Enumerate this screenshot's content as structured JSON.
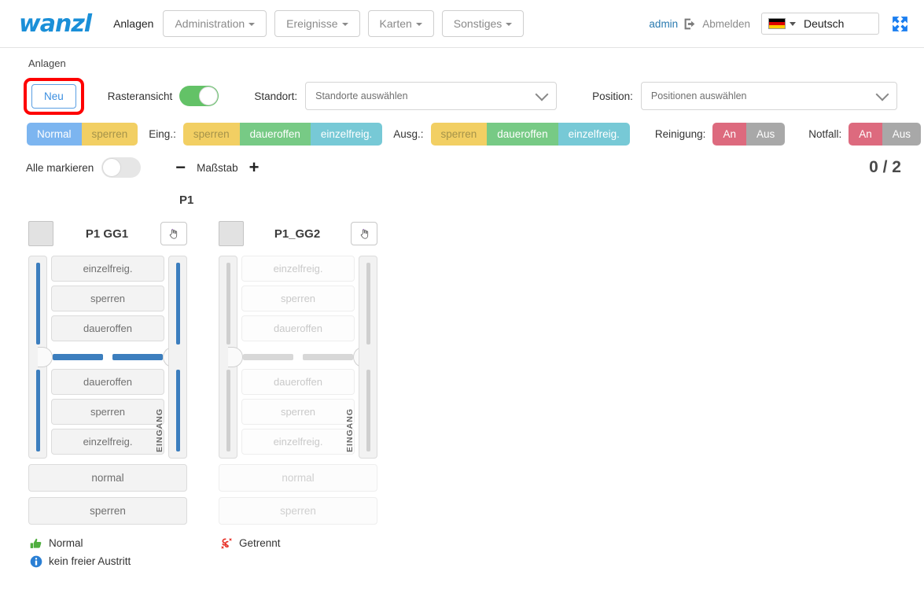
{
  "header": {
    "brand": "wanzl",
    "nav_plain": "Anlagen",
    "nav_buttons": [
      {
        "label": "Administration"
      },
      {
        "label": "Ereignisse"
      },
      {
        "label": "Karten"
      },
      {
        "label": "Sonstiges"
      }
    ],
    "user": "admin",
    "logout_label": "Abmelden",
    "language": "Deutsch",
    "language_flag": "de-flag-icon",
    "fullscreen_icon": "fullscreen-expand-icon"
  },
  "breadcrumb": "Anlagen",
  "toolbar": {
    "new_button": "Neu",
    "raster_label": "Rasteransicht",
    "raster_on": true,
    "standort_label": "Standort:",
    "standort_placeholder": "Standorte auswählen",
    "position_label": "Position:",
    "position_placeholder": "Positionen auswählen"
  },
  "modes": {
    "main": [
      {
        "label": "Normal",
        "style": "c-blue"
      },
      {
        "label": "sperren",
        "style": "c-yellow"
      }
    ],
    "eingang_label": "Eing.:",
    "eingang": [
      {
        "label": "sperren",
        "style": "c-yellow"
      },
      {
        "label": "daueroffen",
        "style": "c-green"
      },
      {
        "label": "einzelfreig.",
        "style": "c-teal"
      }
    ],
    "ausgang_label": "Ausg.:",
    "ausgang": [
      {
        "label": "sperren",
        "style": "c-yellow"
      },
      {
        "label": "daueroffen",
        "style": "c-green"
      },
      {
        "label": "einzelfreig.",
        "style": "c-teal"
      }
    ],
    "reinigung_label": "Reinigung:",
    "reinigung": [
      {
        "label": "An",
        "style": "c-red"
      },
      {
        "label": "Aus",
        "style": "c-gray"
      }
    ],
    "notfall_label": "Notfall:",
    "notfall": [
      {
        "label": "An",
        "style": "c-red"
      },
      {
        "label": "Aus",
        "style": "c-gray"
      }
    ]
  },
  "selection": {
    "select_all_label": "Alle markieren",
    "select_all_on": false,
    "minus": "−",
    "scale_label": "Maßstab",
    "plus": "+",
    "counter": "0 / 2"
  },
  "group_title": "P1",
  "gates": [
    {
      "title": "P1 GG1",
      "active": true,
      "hand_icon": "hand-pointer-icon",
      "checkbox": "gate-select-checkbox",
      "upper_buttons": [
        "einzelfreig.",
        "sperren",
        "daueroffen"
      ],
      "lower_buttons": [
        "daueroffen",
        "sperren",
        "einzelfreig."
      ],
      "entrance_label": "EINGANG",
      "wide_buttons": [
        "normal",
        "sperren"
      ]
    },
    {
      "title": "P1_GG2",
      "active": false,
      "hand_icon": "hand-pointer-icon",
      "checkbox": "gate-select-checkbox",
      "upper_buttons": [
        "einzelfreig.",
        "sperren",
        "daueroffen"
      ],
      "lower_buttons": [
        "daueroffen",
        "sperren",
        "einzelfreig."
      ],
      "entrance_label": "EINGANG",
      "wide_buttons": [
        "normal",
        "sperren"
      ]
    }
  ],
  "status": {
    "col1": [
      {
        "icon": "thumbs-up-icon",
        "label": "Normal"
      },
      {
        "icon": "info-circle-icon",
        "label": "kein freier Austritt"
      }
    ],
    "col2": [
      {
        "icon": "disconnected-icon",
        "label": "Getrennt"
      }
    ]
  },
  "colors": {
    "brand": "#1a8fd8",
    "accent_blue": "#3c7ebe",
    "highlight_red": "#fe0000",
    "toggle_green": "#63c267",
    "mode_blue": "#7cb5f0",
    "mode_yellow": "#f2cf63",
    "mode_green": "#77ca85",
    "mode_teal": "#77c9d6",
    "mode_red": "#dd6a7e",
    "mode_gray": "#a8a8a8"
  }
}
